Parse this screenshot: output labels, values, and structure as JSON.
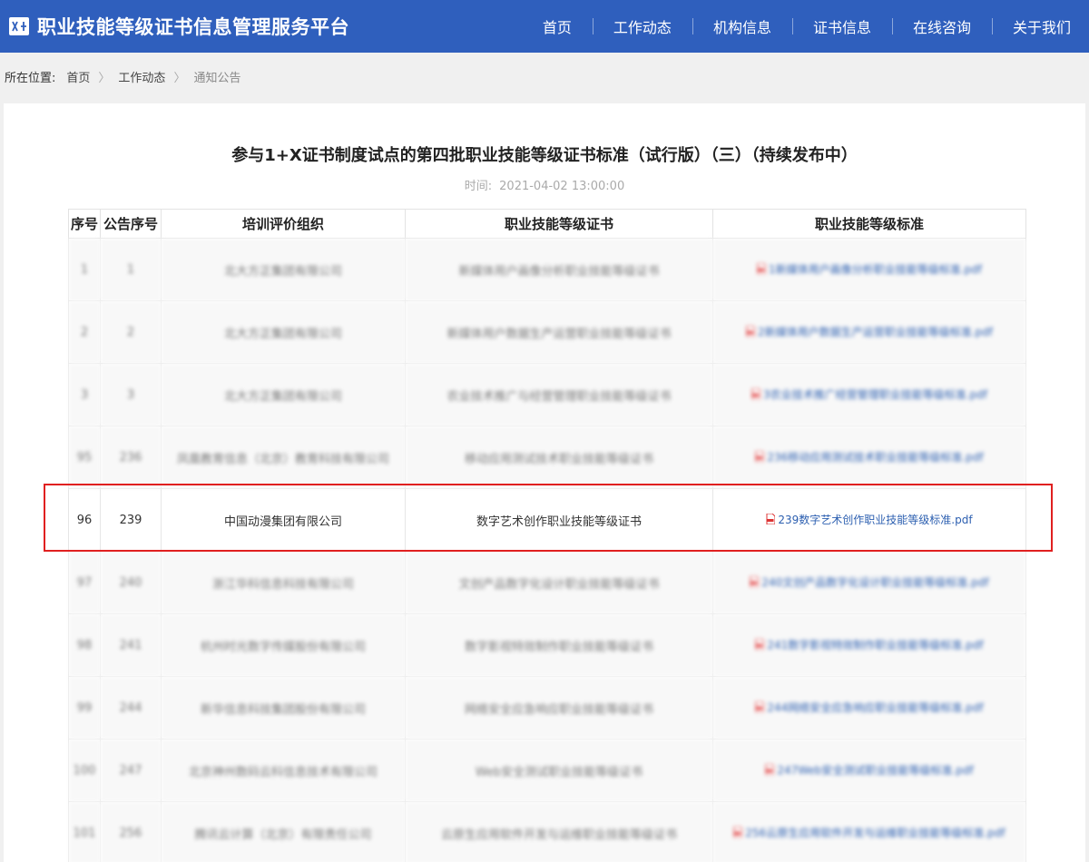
{
  "header": {
    "logo_icon": "book-icon",
    "site_title": "职业技能等级证书信息管理服务平台",
    "nav": [
      "首页",
      "工作动态",
      "机构信息",
      "证书信息",
      "在线咨询",
      "关于我们"
    ]
  },
  "breadcrumb": {
    "prefix": "所在位置:",
    "items": [
      "首页",
      "工作动态",
      "通知公告"
    ]
  },
  "article": {
    "title": "参与1+X证书制度试点的第四批职业技能等级证书标准（试行版）（三）（持续发布中）",
    "time_label": "时间:",
    "time_value": "2021-04-02 13:00:00"
  },
  "table": {
    "headers": [
      "序号",
      "公告序号",
      "培训评价组织",
      "职业技能等级证书",
      "职业技能等级标准"
    ],
    "rows": [
      {
        "seq": "1",
        "notice": "1",
        "org": "北大方正集团有限公司",
        "cert": "新媒体用户画像分析职业技能等级证书",
        "file": "1新媒体用户画像分析职业技能等级标准.pdf",
        "blurred": true
      },
      {
        "seq": "2",
        "notice": "2",
        "org": "北大方正集团有限公司",
        "cert": "新媒体用户数据生产运营职业技能等级证书",
        "file": "2新媒体用户数据生产运营职业技能等级标准.pdf",
        "blurred": true
      },
      {
        "seq": "3",
        "notice": "3",
        "org": "北大方正集团有限公司",
        "cert": "农业技术推广与经营管理职业技能等级证书",
        "file": "3农业技术推广经营管理职业技能等级标准.pdf",
        "blurred": true
      },
      {
        "seq": "95",
        "notice": "236",
        "org": "凤凰教育信息（北京）教育科技有限公司",
        "cert": "移动应用测试技术职业技能等级证书",
        "file": "236移动应用测试技术职业技能等级标准.pdf",
        "blurred": true
      },
      {
        "seq": "96",
        "notice": "239",
        "org": "中国动漫集团有限公司",
        "cert": "数字艺术创作职业技能等级证书",
        "file": "239数字艺术创作职业技能等级标准.pdf",
        "blurred": false
      },
      {
        "seq": "97",
        "notice": "240",
        "org": "浙江华科信息科技有限公司",
        "cert": "文创产品数字化设计职业技能等级证书",
        "file": "240文创产品数字化设计职业技能等级标准.pdf",
        "blurred": true
      },
      {
        "seq": "98",
        "notice": "241",
        "org": "杭州时光数字传媒股份有限公司",
        "cert": "数字影视特效制作职业技能等级证书",
        "file": "241数字影视特效制作职业技能等级标准.pdf",
        "blurred": true
      },
      {
        "seq": "99",
        "notice": "244",
        "org": "新华信息科技集团股份有限公司",
        "cert": "网络安全应急响应职业技能等级证书",
        "file": "244网络安全应急响应职业技能等级标准.pdf",
        "blurred": true
      },
      {
        "seq": "100",
        "notice": "247",
        "org": "北京神州数码云科信息技术有限公司",
        "cert": "Web安全测试职业技能等级证书",
        "file": "247Web安全测试职业技能等级标准.pdf",
        "blurred": true
      },
      {
        "seq": "101",
        "notice": "256",
        "org": "腾讯云计算（北京）有限责任公司",
        "cert": "云原生应用软件开发与运维职业技能等级证书",
        "file": "256云原生应用软件开发与运维职业技能等级标准.pdf",
        "blurred": true
      }
    ]
  },
  "colors": {
    "header_bg": "#2f5fbd",
    "link": "#2c5fb0",
    "highlight_border": "#e02020"
  }
}
